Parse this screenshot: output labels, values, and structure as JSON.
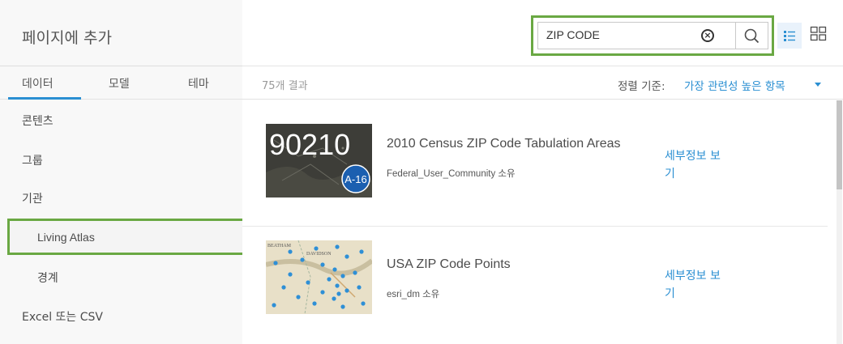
{
  "panel": {
    "title": "페이지에 추가"
  },
  "tabs": [
    {
      "label": "데이터",
      "active": true
    },
    {
      "label": "모델",
      "active": false
    },
    {
      "label": "테마",
      "active": false
    }
  ],
  "sidebar": {
    "items": [
      {
        "label": "콘텐츠"
      },
      {
        "label": "그룹"
      },
      {
        "label": "기관"
      },
      {
        "label": "Living Atlas",
        "highlighted": true
      },
      {
        "label": "경계"
      },
      {
        "label": "Excel 또는 CSV"
      }
    ]
  },
  "search": {
    "value": "ZIP CODE",
    "clear_glyph": "×"
  },
  "results_bar": {
    "count": "75개 결과",
    "sort_label": "정렬 기준:",
    "sort_value": "가장 관련성 높은 항목"
  },
  "results": [
    {
      "title": "2010 Census ZIP Code Tabulation Areas",
      "owner": "Federal_User_Community 소유",
      "details": "세부정보 보\n기",
      "thumb_text": "90210",
      "thumb_badge": "A-16"
    },
    {
      "title": "USA ZIP Code Points",
      "owner": "esri_dm 소유",
      "details": "세부정보 보\n기",
      "thumb_labels": [
        "BEATHAM",
        "DAVIDSON"
      ]
    }
  ],
  "colors": {
    "accent": "#2a8fd2",
    "highlight": "#6aa843",
    "panel_bg": "#f8f8f8"
  },
  "icons": [
    "clear-icon",
    "search-icon",
    "list-view-icon",
    "grid-view-icon",
    "caret-down-icon"
  ]
}
